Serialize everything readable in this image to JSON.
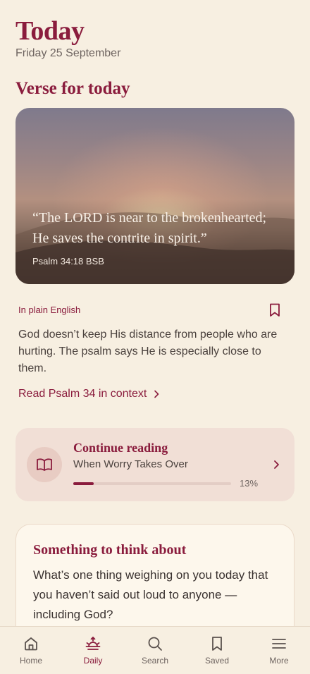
{
  "header": {
    "title": "Today",
    "date": "Friday 25 September"
  },
  "verse_section": {
    "title": "Verse for today",
    "quote": "“The LORD is near to the brokenhearted; He saves the contrite in spirit.”",
    "reference": "Psalm 34:18 BSB"
  },
  "plain_english": {
    "label": "In plain English",
    "icon": "bookmark-icon",
    "text": "God doesn’t keep His distance from people who are hurting. The psalm says He is especially close to them.",
    "link": "Read Psalm 34 in context"
  },
  "continue_reading": {
    "title": "Continue reading",
    "subtitle": "When Worry Takes Over",
    "progress": 0.13,
    "progress_label": "13%",
    "icon": "open-book-icon"
  },
  "reflection": {
    "title": "Something to think about",
    "question": "What’s one thing weighing on you today that you haven’t said out loud to anyone — including God?"
  },
  "tabs": [
    {
      "label": "Home",
      "icon": "home-icon",
      "active": false
    },
    {
      "label": "Daily",
      "icon": "sunrise-icon",
      "active": true
    },
    {
      "label": "Search",
      "icon": "search-icon",
      "active": false
    },
    {
      "label": "Saved",
      "icon": "bookmark-icon",
      "active": false
    },
    {
      "label": "More",
      "icon": "menu-icon",
      "active": false
    }
  ],
  "colors": {
    "accent": "#8a1c3d",
    "background": "#f7efe1",
    "card_tint": "#f1dfd6"
  }
}
